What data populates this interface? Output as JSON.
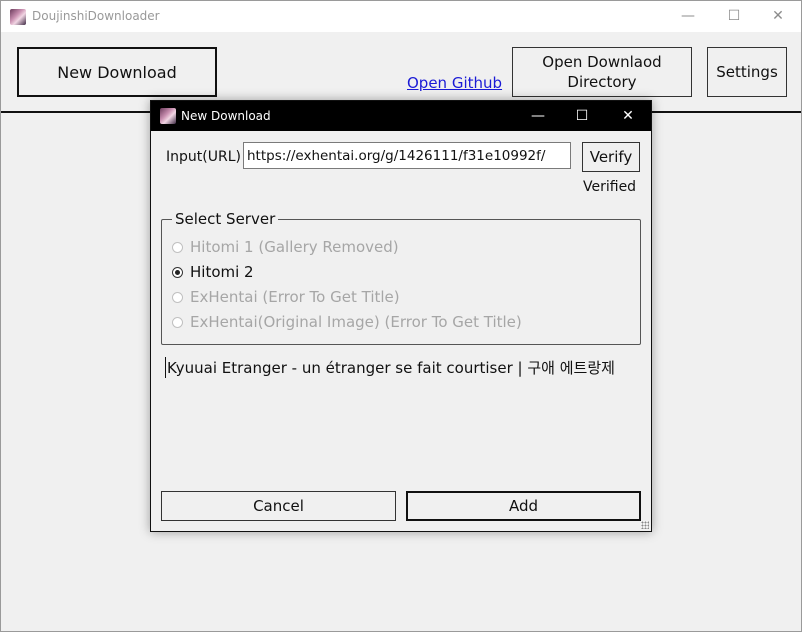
{
  "app": {
    "title": "DoujinshiDownloader",
    "controls": {
      "minimize": "—",
      "maximize": "☐",
      "close": "✕"
    }
  },
  "toolbar": {
    "new_download": "New Download",
    "open_github": "Open Github",
    "open_directory": "Open Downlaod Directory",
    "settings": "Settings"
  },
  "dialog": {
    "title": "New Download",
    "controls": {
      "minimize": "—",
      "maximize": "☐",
      "close": "✕"
    },
    "url_label": "Input(URL)",
    "url_value": "https://exhentai.org/g/1426111/f31e10992f/",
    "verify": "Verify",
    "verified": "Verified",
    "server_group_label": "Select Server",
    "servers": [
      {
        "label": "Hitomi 1 (Gallery Removed)",
        "enabled": false,
        "selected": false
      },
      {
        "label": "Hitomi 2",
        "enabled": true,
        "selected": true
      },
      {
        "label": "ExHentai (Error To Get Title)",
        "enabled": false,
        "selected": false
      },
      {
        "label": "ExHentai(Original Image) (Error To Get Title)",
        "enabled": false,
        "selected": false
      }
    ],
    "gallery_title": "Kyuuai Etranger - un étranger se fait courtiser | 구애 에트랑제",
    "cancel": "Cancel",
    "add": "Add"
  },
  "colors": {
    "link": "#1a1ad6",
    "dialog_titlebar": "#000000",
    "window_bg": "#f0f0f0"
  }
}
